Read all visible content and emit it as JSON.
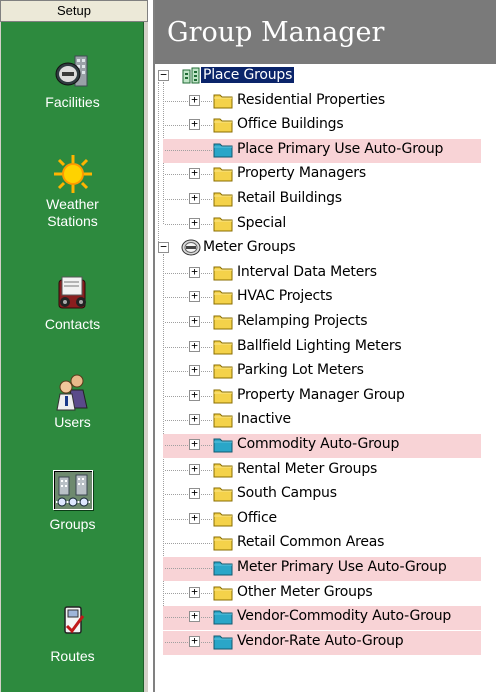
{
  "sidebar": {
    "header": "Setup",
    "items": [
      {
        "label": "Facilities",
        "icon": "facilities-icon"
      },
      {
        "label": "Weather Stations",
        "label_lines": [
          "Weather",
          "Stations"
        ],
        "icon": "weather-sun-icon"
      },
      {
        "label": "Contacts",
        "icon": "contacts-rolodex-icon"
      },
      {
        "label": "Users",
        "icon": "users-icon"
      },
      {
        "label": "Groups",
        "icon": "groups-icon",
        "active": true
      },
      {
        "label": "Routes",
        "icon": "routes-icon"
      }
    ]
  },
  "main": {
    "title": "Group Manager",
    "tree": {
      "place_groups": {
        "label": "Place Groups",
        "children": [
          {
            "label": "Residential Properties",
            "type": "folder"
          },
          {
            "label": "Office Buildings",
            "type": "folder"
          },
          {
            "label": "Place Primary Use Auto-Group",
            "type": "auto-folder",
            "highlighted": true
          },
          {
            "label": "Property Managers",
            "type": "folder"
          },
          {
            "label": "Retail Buildings",
            "type": "folder"
          },
          {
            "label": "Special",
            "type": "folder"
          }
        ]
      },
      "meter_groups": {
        "label": "Meter Groups",
        "children": [
          {
            "label": "Interval Data Meters",
            "type": "folder"
          },
          {
            "label": "HVAC Projects",
            "type": "folder"
          },
          {
            "label": "Relamping Projects",
            "type": "folder"
          },
          {
            "label": "Ballfield Lighting Meters",
            "type": "folder"
          },
          {
            "label": "Parking Lot Meters",
            "type": "folder"
          },
          {
            "label": "Property Manager Group",
            "type": "folder"
          },
          {
            "label": "Inactive",
            "type": "folder"
          },
          {
            "label": "Commodity Auto-Group",
            "type": "auto-folder",
            "highlighted": true
          },
          {
            "label": "Rental Meter Groups",
            "type": "folder"
          },
          {
            "label": "South Campus",
            "type": "folder"
          },
          {
            "label": "Office",
            "type": "folder"
          },
          {
            "label": "Retail Common Areas",
            "type": "folder"
          },
          {
            "label": "Meter Primary Use Auto-Group",
            "type": "auto-folder",
            "highlighted": true
          },
          {
            "label": "Other Meter Groups",
            "type": "folder"
          },
          {
            "label": "Vendor-Commodity Auto-Group",
            "type": "auto-folder",
            "highlighted": true
          },
          {
            "label": "Vendor-Rate Auto-Group",
            "type": "auto-folder",
            "highlighted": true
          }
        ]
      }
    }
  },
  "colors": {
    "sidebar_green": "#2d8a3e",
    "title_gray": "#7a7a7a",
    "highlight_pink": "#f8d3d6",
    "folder_yellow": "#f4d24a",
    "auto_folder_teal": "#2aa6c8",
    "selection_navy": "#0a246a"
  }
}
